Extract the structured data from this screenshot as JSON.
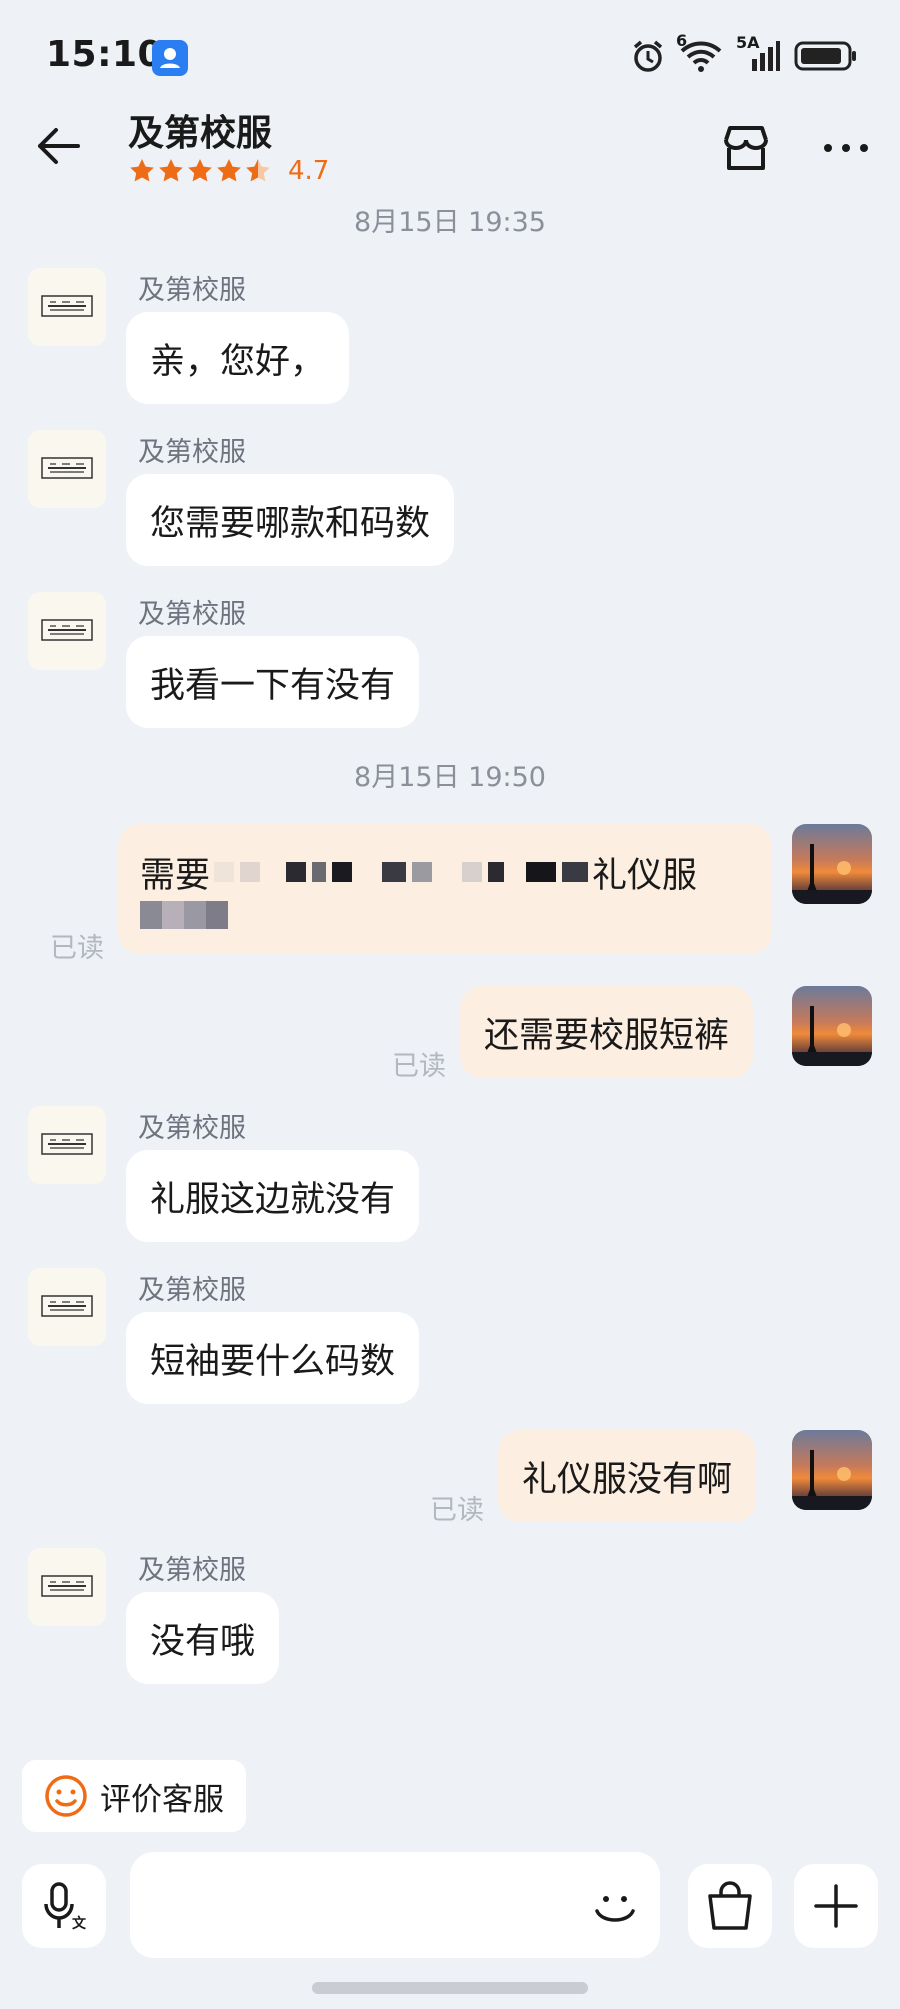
{
  "status_bar": {
    "time": "15:10",
    "network_sim1": "6",
    "network_sim2": "5A"
  },
  "header": {
    "title": "及第校服",
    "rating": "4.7",
    "rating_stars": 4.5,
    "icons": [
      "back-arrow-icon",
      "store-icon",
      "more-icon"
    ]
  },
  "messages": {
    "ts1": "8月15日 19:35",
    "ts2": "8月15日 19:50",
    "m1": {
      "sender": "及第校服",
      "text": "亲，您好，"
    },
    "m2": {
      "sender": "及第校服",
      "text": "您需要哪款和码数"
    },
    "m3": {
      "sender": "及第校服",
      "text": "我看一下有没有"
    },
    "m4": {
      "text_start": "需要",
      "text_end": "礼仪服",
      "read": "已读"
    },
    "m5": {
      "text": "还需要校服短裤",
      "read": "已读"
    },
    "m6": {
      "sender": "及第校服",
      "text": "礼服这边就没有"
    },
    "m7": {
      "sender": "及第校服",
      "text": "短袖要什么码数"
    },
    "m8": {
      "text": "礼仪服没有啊",
      "read": "已读"
    },
    "m9": {
      "sender": "及第校服",
      "text": "没有哦"
    }
  },
  "bottom": {
    "rate_service_label": "评价客服",
    "input_value": "",
    "icons": [
      "voice-input-icon",
      "emoji-icon",
      "shopping-bag-icon",
      "plus-icon"
    ]
  },
  "colors": {
    "accent_orange": "#ef6c16",
    "outgoing_bubble": "#fdeee2",
    "background": "#eef1f6"
  }
}
